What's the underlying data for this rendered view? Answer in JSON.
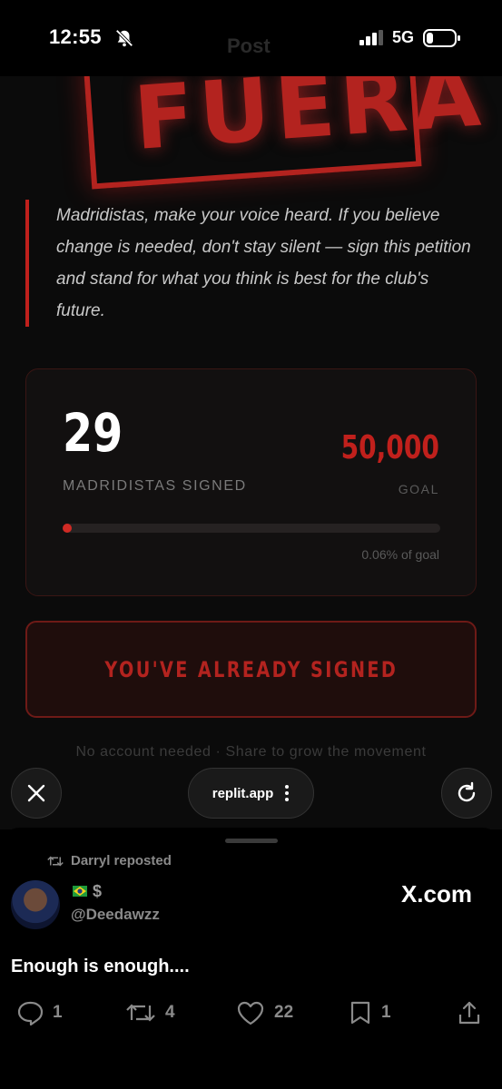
{
  "status_bar": {
    "time": "12:55",
    "network": "5G",
    "faint_title": "Post"
  },
  "hero": {
    "stamp_text": "FUERA"
  },
  "quote": "Madridistas, make your voice heard. If you believe change is needed, don't stay silent — sign this petition and stand for what you think is best for the club's future.",
  "counter": {
    "count": "29",
    "count_label": "MADRIDISTAS SIGNED",
    "goal": "50,000",
    "goal_label": "GOAL",
    "progress_fraction": 0.0006,
    "progress_text": "0.06% of goal"
  },
  "signed_button": {
    "label": "YOU'VE ALREADY SIGNED"
  },
  "footnote": "No account needed · Share to grow the movement",
  "browser": {
    "url": "replit.app"
  },
  "tweet": {
    "reposted_by": "Darryl reposted",
    "handle": "@Deedawzz",
    "brand": "X.com",
    "text": "Enough is enough....",
    "replies": "1",
    "reposts": "4",
    "likes": "22",
    "bookmarks": "1"
  },
  "colors": {
    "accent_red": "#c0201c",
    "background": "#0b0b0b"
  }
}
